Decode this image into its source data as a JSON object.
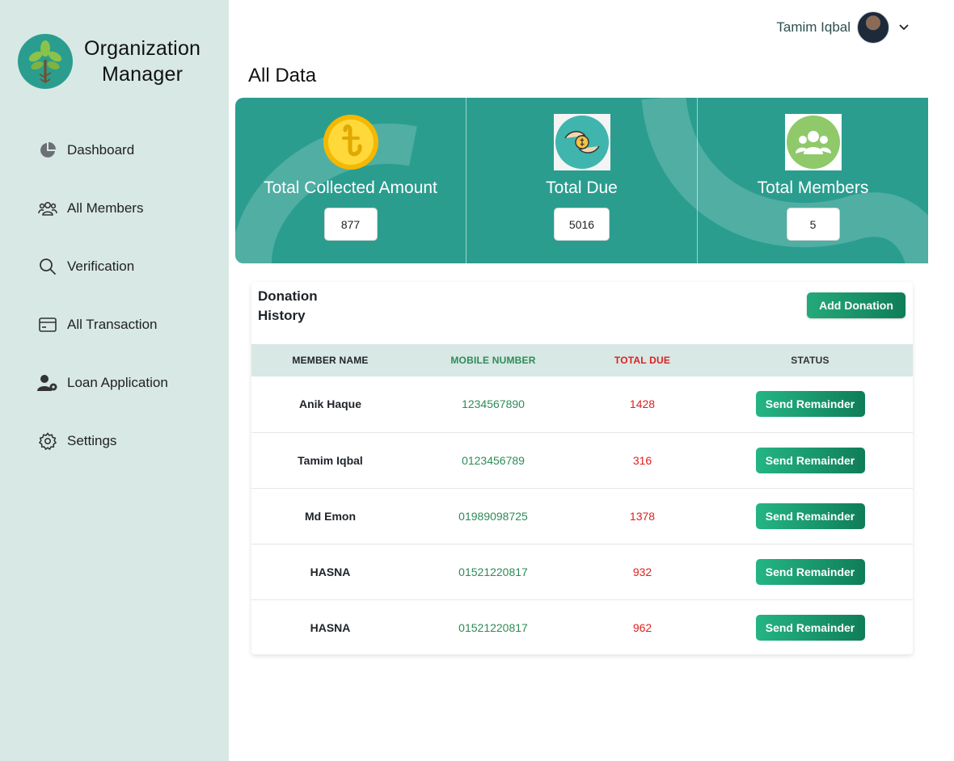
{
  "brand": {
    "name_line1": "Organization",
    "name_line2": "Manager",
    "accent": "#2a9d8f"
  },
  "sidebar": {
    "items": [
      {
        "label": "Dashboard",
        "icon": "pie-chart-icon"
      },
      {
        "label": "All Members",
        "icon": "users-icon"
      },
      {
        "label": "Verification",
        "icon": "search-icon"
      },
      {
        "label": "All Transaction",
        "icon": "credit-card-icon"
      },
      {
        "label": "Loan Application",
        "icon": "user-gear-icon"
      },
      {
        "label": "Settings",
        "icon": "gear-icon"
      }
    ]
  },
  "header": {
    "user_name": "Tamim Iqbal",
    "page_title": "All Data"
  },
  "stats": [
    {
      "label": "Total Collected Amount",
      "value": "877",
      "icon": "taka-coin-icon"
    },
    {
      "label": "Total Due",
      "value": "5016",
      "icon": "money-hands-icon"
    },
    {
      "label": "Total Members",
      "value": "5",
      "icon": "members-group-icon"
    }
  ],
  "donation": {
    "title": "Donation History",
    "add_button": "Add Donation",
    "columns": [
      "MEMBER NAME",
      "MOBILE NUMBER",
      "TOTAL DUE",
      "STATUS"
    ],
    "rows": [
      {
        "name": "Anik Haque",
        "mobile": "1234567890",
        "due": "1428",
        "action": "Send Remainder"
      },
      {
        "name": "Tamim Iqbal",
        "mobile": "0123456789",
        "due": "316",
        "action": "Send Remainder"
      },
      {
        "name": "Md Emon",
        "mobile": "01989098725",
        "due": "1378",
        "action": "Send Remainder"
      },
      {
        "name": "HASNA",
        "mobile": "01521220817",
        "due": "932",
        "action": "Send Remainder"
      },
      {
        "name": "HASNA",
        "mobile": "01521220817",
        "due": "962",
        "action": "Send Remainder"
      }
    ]
  },
  "colors": {
    "sidebar_bg": "#d7e8e5",
    "banner": "#2a9d8f",
    "due_red": "#e02020",
    "mobile_green": "#2e8b57",
    "button_green": "#0f7d58"
  }
}
